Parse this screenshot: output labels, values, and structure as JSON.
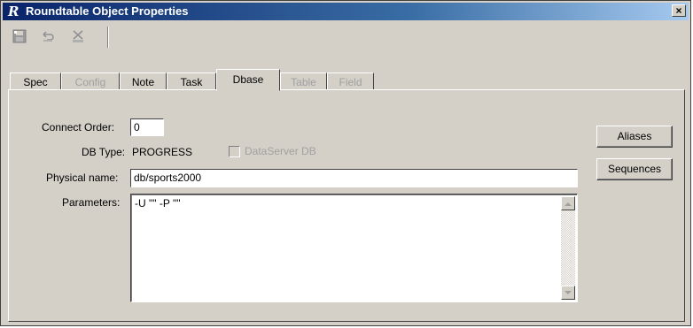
{
  "window": {
    "logo_text": "R",
    "title": "Roundtable Object Properties",
    "close_glyph": "×"
  },
  "toolbar": {
    "buttons": [
      {
        "name": "save-icon",
        "enabled": false
      },
      {
        "name": "undo-icon",
        "enabled": false
      },
      {
        "name": "delete-icon",
        "enabled": false
      }
    ]
  },
  "tabs": [
    {
      "label": "Spec",
      "state": "normal"
    },
    {
      "label": "Config",
      "state": "disabled"
    },
    {
      "label": "Note",
      "state": "normal"
    },
    {
      "label": "Task",
      "state": "normal"
    },
    {
      "label": "Dbase",
      "state": "active"
    },
    {
      "label": "Table",
      "state": "disabled"
    },
    {
      "label": "Field",
      "state": "disabled"
    }
  ],
  "form": {
    "connect_order_label": "Connect Order:",
    "connect_order_value": "0",
    "db_type_label": "DB Type:",
    "db_type_value": "PROGRESS",
    "dataserver_label": "DataServer DB",
    "dataserver_checked": false,
    "physical_name_label": "Physical name:",
    "physical_name_value": "db/sports2000",
    "parameters_label": "Parameters:",
    "parameters_value": "-U \"\" -P \"\""
  },
  "buttons": {
    "aliases_label": "Aliases",
    "sequences_label": "Sequences"
  }
}
